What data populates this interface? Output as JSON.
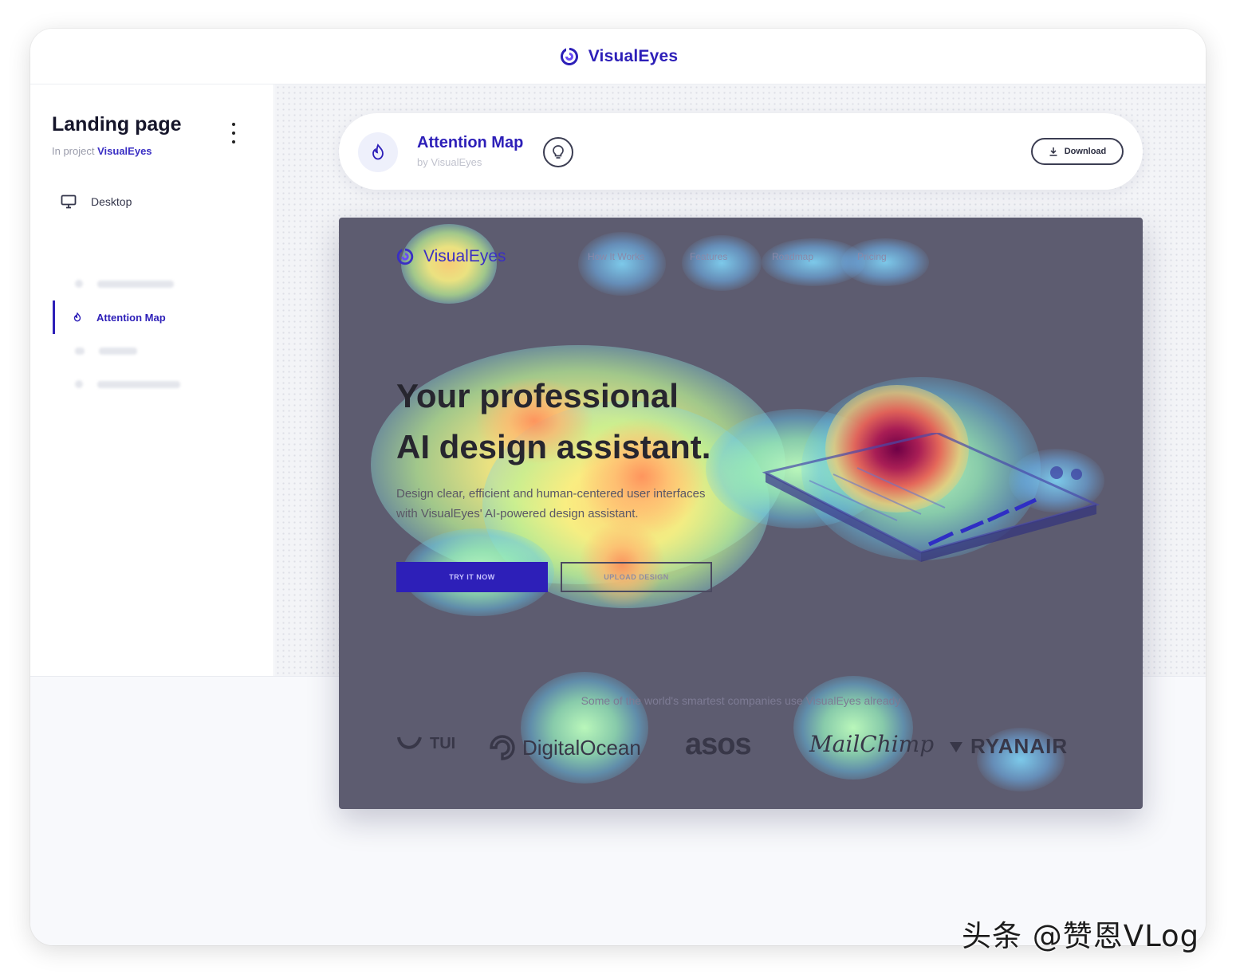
{
  "app": {
    "brand_name": "VisualEyes",
    "accent": "#2d1fb8"
  },
  "sidebar": {
    "title": "Landing page",
    "subtitle_prefix": "In project",
    "project_name": "VisualEyes",
    "device_label": "Desktop",
    "active_item": "Attention Map"
  },
  "result_card": {
    "title": "Attention Map",
    "subtitle": "by VisualEyes",
    "download_label": "Download"
  },
  "heatmap_preview": {
    "brand": "VisualEyes",
    "nav": [
      "How It Works",
      "Features",
      "Roadmap",
      "Pricing"
    ],
    "headline_line1": "Your professional",
    "headline_line2": "AI design assistant.",
    "paragraph": "Design clear, efficient and human-centered user interfaces with VisualEyes' AI-powered design assistant.",
    "cta_primary": "TRY IT NOW",
    "cta_secondary": "UPLOAD DESIGN",
    "trust_line": "Some of the world's smartest companies use VisualEyes already",
    "logos": [
      "TUI",
      "DigitalOcean",
      "asos",
      "MailChimp",
      "RYANAIR"
    ]
  },
  "watermark": "头条 @赞恩VLog"
}
